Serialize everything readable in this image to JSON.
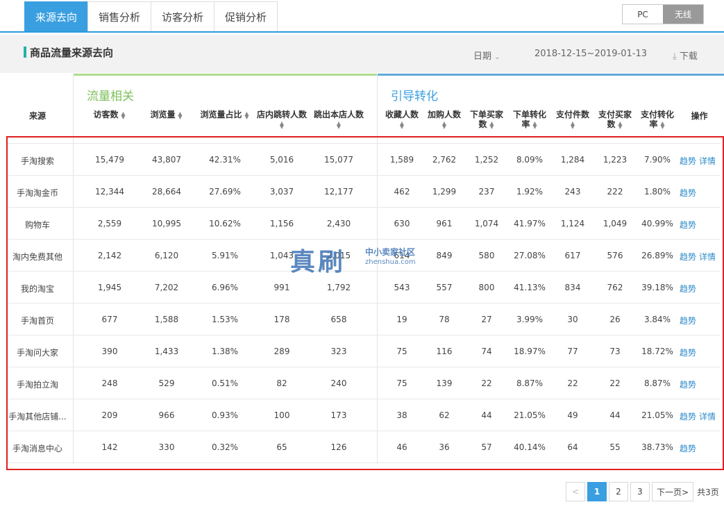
{
  "tabs": [
    "来源去向",
    "销售分析",
    "访客分析",
    "促销分析"
  ],
  "device": {
    "pc": "PC",
    "wireless": "无线"
  },
  "header": {
    "title": "商品流量来源去向",
    "date_label": "日期",
    "date_range": "2018-12-15~2019-01-13",
    "download": "下载"
  },
  "groups": {
    "flow": "流量相关",
    "guide": "引导转化"
  },
  "columns": {
    "source": "来源",
    "visitors": "访客数",
    "pageviews": "浏览量",
    "pv_share": "浏览量占比",
    "store_jump": "店内跳转人数",
    "exit": "跳出本店人数",
    "favorites": "收藏人数",
    "add_cart": "加购人数",
    "order_buyers_1": "下单买家",
    "order_buyers_2": "数",
    "order_conv_1": "下单转化",
    "order_conv_2": "率",
    "paid_items": "支付件数",
    "paid_buyers_1": "支付买家",
    "paid_buyers_2": "数",
    "paid_conv_1": "支付转化",
    "paid_conv_2": "率",
    "ops": "操作"
  },
  "actions": {
    "trend": "趋势",
    "detail": "详情"
  },
  "rows": [
    {
      "source": "手淘搜索",
      "v": [
        "15,479",
        "43,807",
        "42.31%",
        "5,016",
        "15,077",
        "1,589",
        "2,762",
        "1,252",
        "8.09%",
        "1,284",
        "1,223",
        "7.90%"
      ],
      "detail": true
    },
    {
      "source": "手淘淘金币",
      "v": [
        "12,344",
        "28,664",
        "27.69%",
        "3,037",
        "12,177",
        "462",
        "1,299",
        "237",
        "1.92%",
        "243",
        "222",
        "1.80%"
      ],
      "detail": false
    },
    {
      "source": "购物车",
      "v": [
        "2,559",
        "10,995",
        "10.62%",
        "1,156",
        "2,430",
        "630",
        "961",
        "1,074",
        "41.97%",
        "1,124",
        "1,049",
        "40.99%"
      ],
      "detail": false
    },
    {
      "source": "淘内免费其他",
      "v": [
        "2,142",
        "6,120",
        "5.91%",
        "1,043",
        "2,015",
        "614",
        "849",
        "580",
        "27.08%",
        "617",
        "576",
        "26.89%"
      ],
      "detail": true
    },
    {
      "source": "我的淘宝",
      "v": [
        "1,945",
        "7,202",
        "6.96%",
        "991",
        "1,792",
        "543",
        "557",
        "800",
        "41.13%",
        "834",
        "762",
        "39.18%"
      ],
      "detail": false
    },
    {
      "source": "手淘首页",
      "v": [
        "677",
        "1,588",
        "1.53%",
        "178",
        "658",
        "19",
        "78",
        "27",
        "3.99%",
        "30",
        "26",
        "3.84%"
      ],
      "detail": false
    },
    {
      "source": "手淘问大家",
      "v": [
        "390",
        "1,433",
        "1.38%",
        "289",
        "323",
        "75",
        "116",
        "74",
        "18.97%",
        "77",
        "73",
        "18.72%"
      ],
      "detail": false
    },
    {
      "source": "手淘拍立淘",
      "v": [
        "248",
        "529",
        "0.51%",
        "82",
        "240",
        "75",
        "139",
        "22",
        "8.87%",
        "22",
        "22",
        "8.87%"
      ],
      "detail": false
    },
    {
      "source": "手淘其他店铺...",
      "v": [
        "209",
        "966",
        "0.93%",
        "100",
        "173",
        "38",
        "62",
        "44",
        "21.05%",
        "49",
        "44",
        "21.05%"
      ],
      "detail": true
    },
    {
      "source": "手淘消息中心",
      "v": [
        "142",
        "330",
        "0.32%",
        "65",
        "126",
        "46",
        "36",
        "57",
        "40.14%",
        "64",
        "55",
        "38.73%"
      ],
      "detail": false
    }
  ],
  "watermark": {
    "big": "真刷",
    "cn": "中小卖家社区",
    "en": "zhenshua.com"
  },
  "pagination": {
    "prev": "<",
    "pages": [
      "1",
      "2",
      "3"
    ],
    "current": "1",
    "next": "下一页>",
    "total": "共3页"
  }
}
